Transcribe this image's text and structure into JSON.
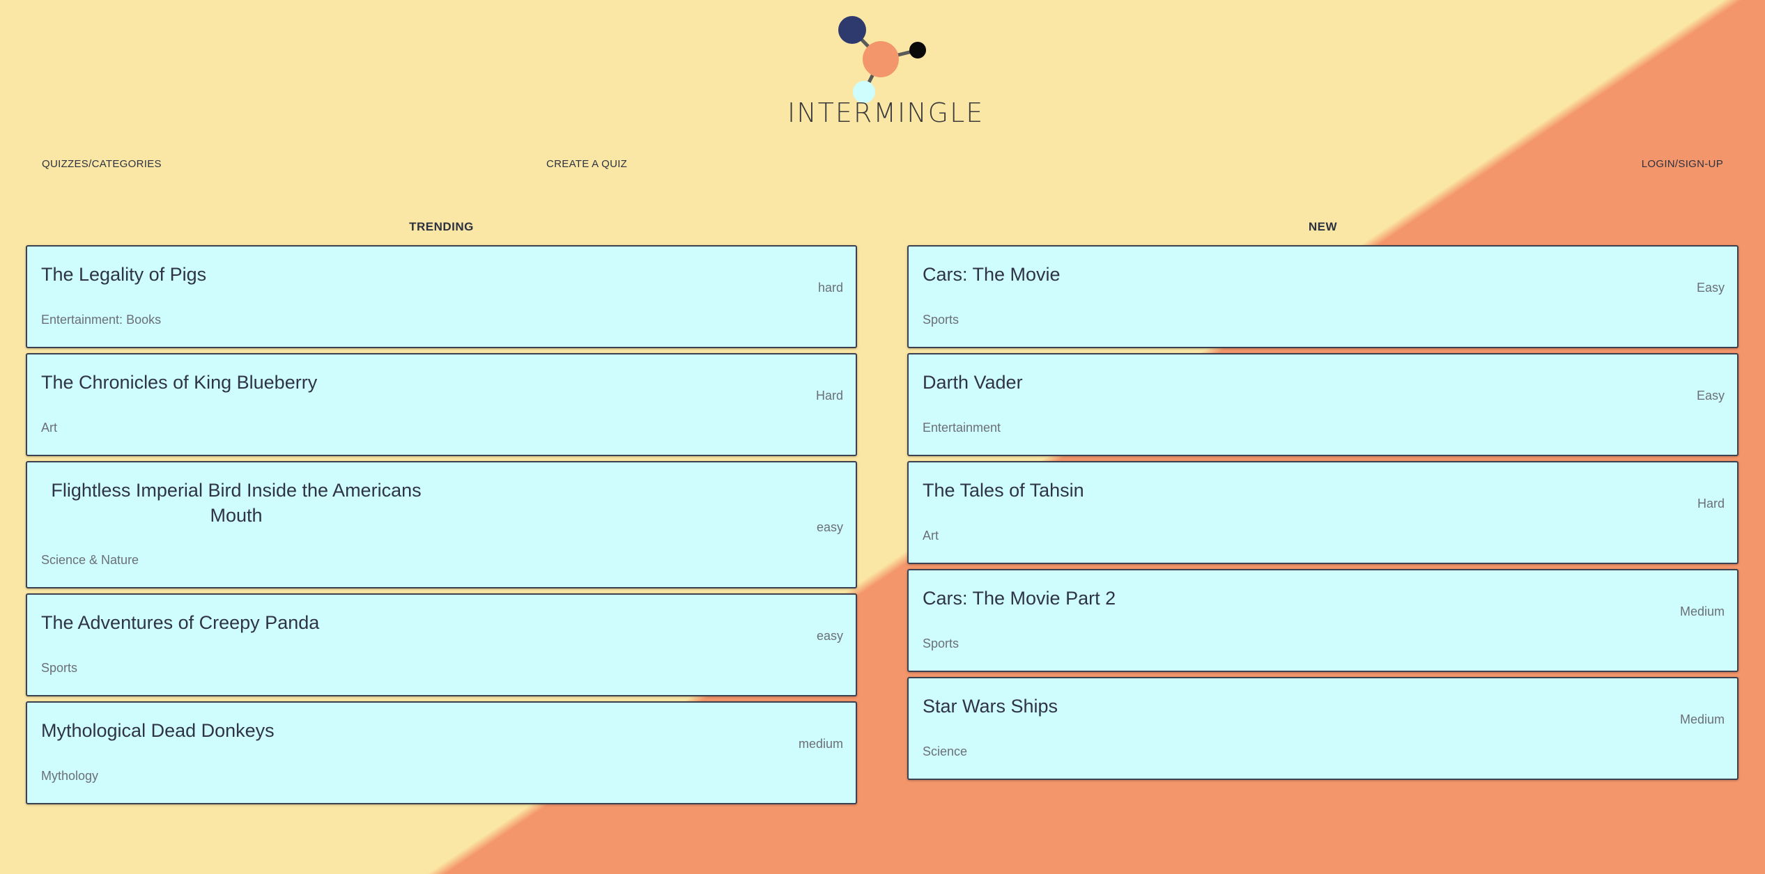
{
  "brand": {
    "name": "INTERMINGLE"
  },
  "colors": {
    "bg_light": "#fbe7a5",
    "bg_accent": "#f4966b",
    "card": "#cffdfd",
    "text": "#2b3140"
  },
  "nav": {
    "quizzes": "QUIZZES/CATEGORIES",
    "create": "CREATE A QUIZ",
    "login": "LOGIN/SIGN-UP"
  },
  "trending": {
    "heading": "TRENDING",
    "quizzes": [
      {
        "title": "The Legality of Pigs",
        "difficulty": "hard",
        "category": "Entertainment: Books"
      },
      {
        "title": "The Chronicles of King Blueberry",
        "difficulty": "Hard",
        "category": "Art"
      },
      {
        "title": "Flightless Imperial Bird Inside the Americans Mouth",
        "difficulty": "easy",
        "category": "Science & Nature"
      },
      {
        "title": "The Adventures of Creepy Panda",
        "difficulty": "easy",
        "category": "Sports"
      },
      {
        "title": "Mythological Dead Donkeys",
        "difficulty": "medium",
        "category": "Mythology"
      }
    ]
  },
  "new": {
    "heading": "NEW",
    "quizzes": [
      {
        "title": "Cars: The Movie",
        "difficulty": "Easy",
        "category": "Sports"
      },
      {
        "title": "Darth Vader",
        "difficulty": "Easy",
        "category": "Entertainment"
      },
      {
        "title": "The Tales of Tahsin",
        "difficulty": "Hard",
        "category": "Art"
      },
      {
        "title": "Cars: The Movie Part 2",
        "difficulty": "Medium",
        "category": "Sports"
      },
      {
        "title": "Star Wars Ships",
        "difficulty": "Medium",
        "category": "Science"
      }
    ]
  }
}
